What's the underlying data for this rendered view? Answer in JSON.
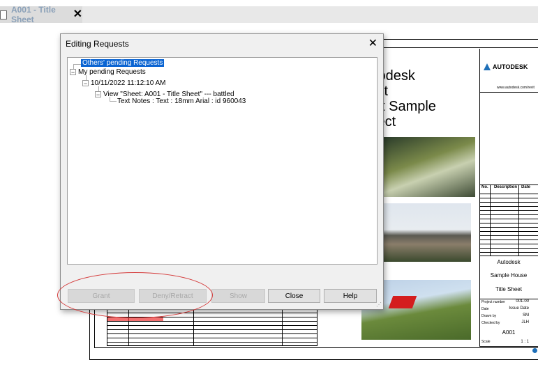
{
  "tab": {
    "title": "A001 - Title Sheet",
    "close": "✕"
  },
  "dialog": {
    "title": "Editing Requests",
    "close": "✕",
    "tree": {
      "others": "Others' pending Requests",
      "mine": "My pending Requests",
      "timestamp": "10/11/2022 11:12:10 AM",
      "view": "View \"Sheet: A001 - Title Sheet\" --- battled",
      "element": "Text Notes : Text : 18mm Arial : id 960043"
    },
    "buttons": {
      "grant": "Grant",
      "deny": "Deny/Retract",
      "show": "Show",
      "close": "Close",
      "help": "Help"
    }
  },
  "sheet": {
    "title_lines": [
      "todesk",
      "vit",
      "st Sample",
      "ject"
    ],
    "logo": "AUTODESK",
    "site": "www.autodesk.com/revit",
    "rev_no": "No.",
    "rev_desc": "Description",
    "rev_date": "Date",
    "company": "Autodesk",
    "project": "Sample House",
    "sheet_name": "Title Sheet",
    "project_number_label": "Project number",
    "project_number": "001-00",
    "date_label": "Date",
    "date": "Issue Date",
    "drawn_label": "Drawn by",
    "drawn": "SM",
    "checked_label": "Checked by",
    "checked": "JLH",
    "sheet_number": "A001",
    "scale_label": "Scale",
    "scale": "1 : 1"
  },
  "colors": {
    "selection": "#0a64d2",
    "annotation_oval": "#d43a3a"
  }
}
